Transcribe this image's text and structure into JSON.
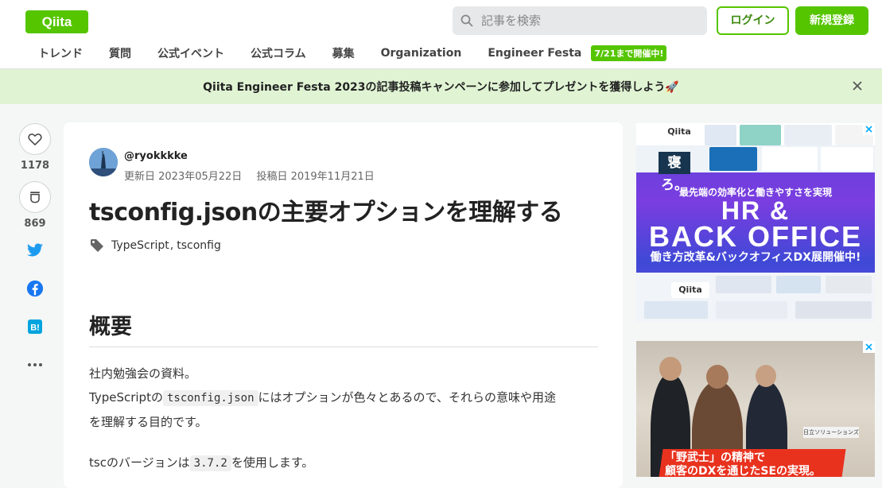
{
  "header": {
    "logo": "Qiita",
    "search_placeholder": "記事を検索",
    "login_label": "ログイン",
    "signup_label": "新規登録",
    "nav": [
      "トレンド",
      "質問",
      "公式イベント",
      "公式コラム",
      "募集",
      "Organization",
      "Engineer Festa"
    ],
    "festa_badge": "7/21まで開催中!"
  },
  "banner": {
    "text": "Qiita Engineer Festa 2023の記事投稿キャンペーンに参加してプレゼントを獲得しよう🚀"
  },
  "rail": {
    "likes": "1178",
    "stocks": "869"
  },
  "article": {
    "username": "@ryokkkke",
    "updated": "更新日 2023年05月22日",
    "posted": "投稿日 2019年11月21日",
    "title": "tsconfig.jsonの主要オプションを理解する",
    "tags": [
      "TypeScript",
      "tsconfig"
    ],
    "tag_sep": ",",
    "section_heading": "概要",
    "para1_line1": "社内勉強会の資料。",
    "para1_pre": "TypeScriptの",
    "para1_code": "tsconfig.json",
    "para1_post": "にはオプションが色々とあるので、それらの意味や用途",
    "para1_line3": "を理解する目的です。",
    "para2_pre": "tscのバージョンは",
    "para2_code": "3.7.2",
    "para2_post": "を使用します。"
  },
  "ads": {
    "ad1": {
      "qiita": "Qiita",
      "neru": "寝ろ。",
      "subtitle": "最先端の効率化と働きやすさを実現",
      "big1": "HR &",
      "big2": "BACK OFFICE",
      "caption": "働き方改革&バックオフィスDX展開催中!",
      "qiita2": "Qiita"
    },
    "ad2": {
      "sign": "日立ソリューションズ",
      "text_line1": "「野武士」の精神で",
      "text_line2": "顧客のDXを通じたSEの実現。"
    }
  },
  "colors": {
    "brand": "#55c500",
    "banner_bg": "#e0f4d4"
  }
}
